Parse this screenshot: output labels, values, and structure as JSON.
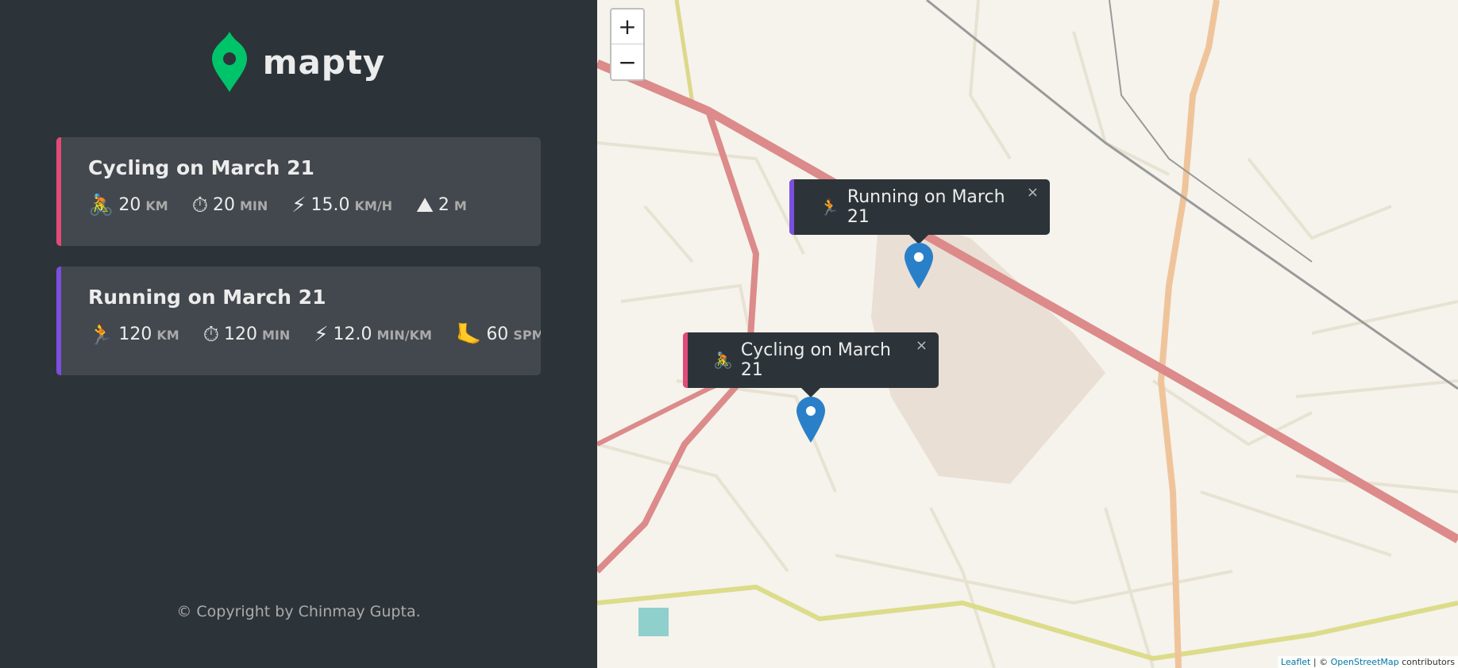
{
  "app": {
    "logo_text": "mapty",
    "brand_color": "#00c46a"
  },
  "workouts": [
    {
      "type": "cycling",
      "title": "Cycling on March 21",
      "accent": "#e34a7a",
      "details": [
        {
          "icon": "🚴",
          "icon_name": "cyclist-icon",
          "value": "20",
          "unit": "km"
        },
        {
          "icon": "⏱",
          "icon_name": "stopwatch-icon",
          "value": "20",
          "unit": "min"
        },
        {
          "icon": "⚡",
          "icon_name": "lightning-icon",
          "value": "15.0",
          "unit": "km/h"
        },
        {
          "icon": "⛰",
          "icon_name": "mountain-icon",
          "value": "2",
          "unit": "m"
        }
      ]
    },
    {
      "type": "running",
      "title": "Running on March 21",
      "accent": "#7b4fe0",
      "details": [
        {
          "icon": "🏃",
          "icon_name": "runner-icon",
          "value": "120",
          "unit": "km"
        },
        {
          "icon": "⏱",
          "icon_name": "stopwatch-icon",
          "value": "120",
          "unit": "min"
        },
        {
          "icon": "⚡",
          "icon_name": "lightning-icon",
          "value": "12.0",
          "unit": "min/km"
        },
        {
          "icon": "🦶",
          "icon_name": "foot-icon",
          "value": "60",
          "unit": "spm"
        }
      ]
    }
  ],
  "copyright": "© Copyright by Chinmay Gupta.",
  "map": {
    "zoom_in": "+",
    "zoom_out": "−",
    "popups": {
      "running": {
        "icon": "🏃",
        "text": "Running on March 21",
        "close": "×"
      },
      "cycling": {
        "icon": "🚴",
        "text": "Cycling on March 21",
        "close": "×"
      }
    },
    "attribution": {
      "leaflet": "Leaflet",
      "sep": " | © ",
      "osm": "OpenStreetMap",
      "suffix": " contributors"
    }
  }
}
